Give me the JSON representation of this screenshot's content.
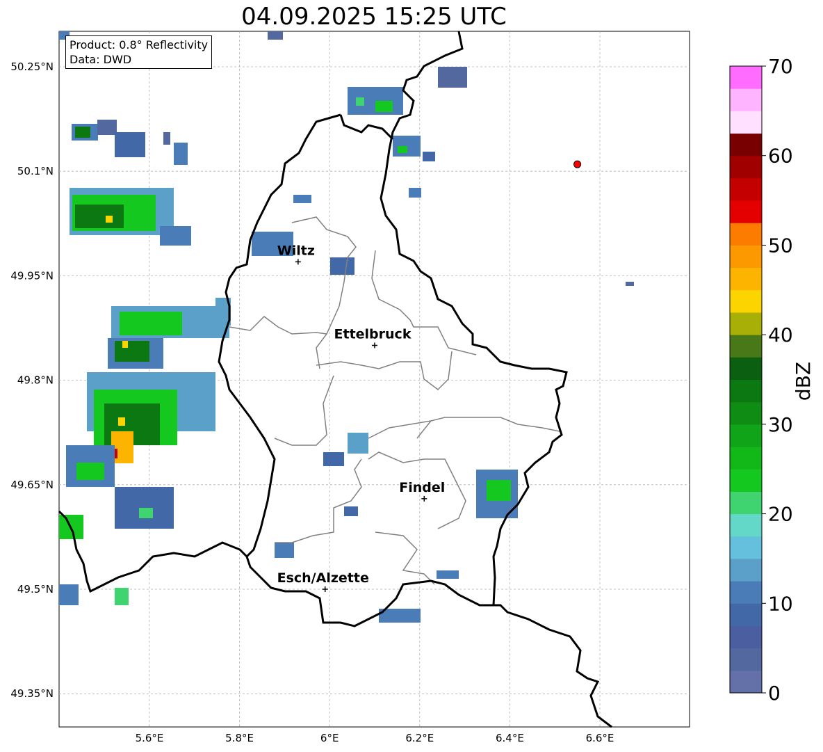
{
  "title": "04.09.2025 15:25 UTC",
  "info": {
    "product": "Product: 0.8° Reflectivity",
    "source": "Data: DWD"
  },
  "map": {
    "lon_range": [
      5.4,
      6.8
    ],
    "lat_range": [
      49.3,
      50.3
    ],
    "lon_ticks": [
      "5.6°E",
      "5.8°E",
      "6°E",
      "6.2°E",
      "6.4°E",
      "6.6°E"
    ],
    "lat_ticks": [
      "50.25°N",
      "50.1°N",
      "49.95°N",
      "49.8°N",
      "49.65°N",
      "49.5°N",
      "49.35°N"
    ],
    "gridlines": true,
    "cities": [
      {
        "name": "Wiltz",
        "lon": 5.93,
        "lat": 49.97
      },
      {
        "name": "Ettelbruck",
        "lon": 6.1,
        "lat": 49.85
      },
      {
        "name": "Findel",
        "lon": 6.21,
        "lat": 49.63
      },
      {
        "name": "Esch/Alzette",
        "lon": 5.99,
        "lat": 49.5
      }
    ],
    "radar_site": {
      "lon": 6.55,
      "lat": 50.11,
      "color": "#ff0000"
    }
  },
  "colorbar": {
    "label": "dBZ",
    "ticks": [
      "0",
      "10",
      "20",
      "30",
      "40",
      "50",
      "60",
      "70"
    ],
    "range": [
      0,
      70
    ],
    "step": 2.5,
    "colors": [
      "#6470a8",
      "#5468a0",
      "#4a5ea0",
      "#4268a8",
      "#4a7cb8",
      "#5aa0c8",
      "#64c0dc",
      "#64d8c8",
      "#40d470",
      "#14c820",
      "#12b818",
      "#10a418",
      "#0e8c14",
      "#0c7812",
      "#0a6010",
      "#487818",
      "#a8b008",
      "#fcd400",
      "#fcb400",
      "#fc9800",
      "#fc7c00",
      "#e40000",
      "#c40000",
      "#a00000",
      "#780000",
      "#ffe0ff",
      "#ffb4ff",
      "#ff6cff",
      "#e838e8"
    ]
  }
}
